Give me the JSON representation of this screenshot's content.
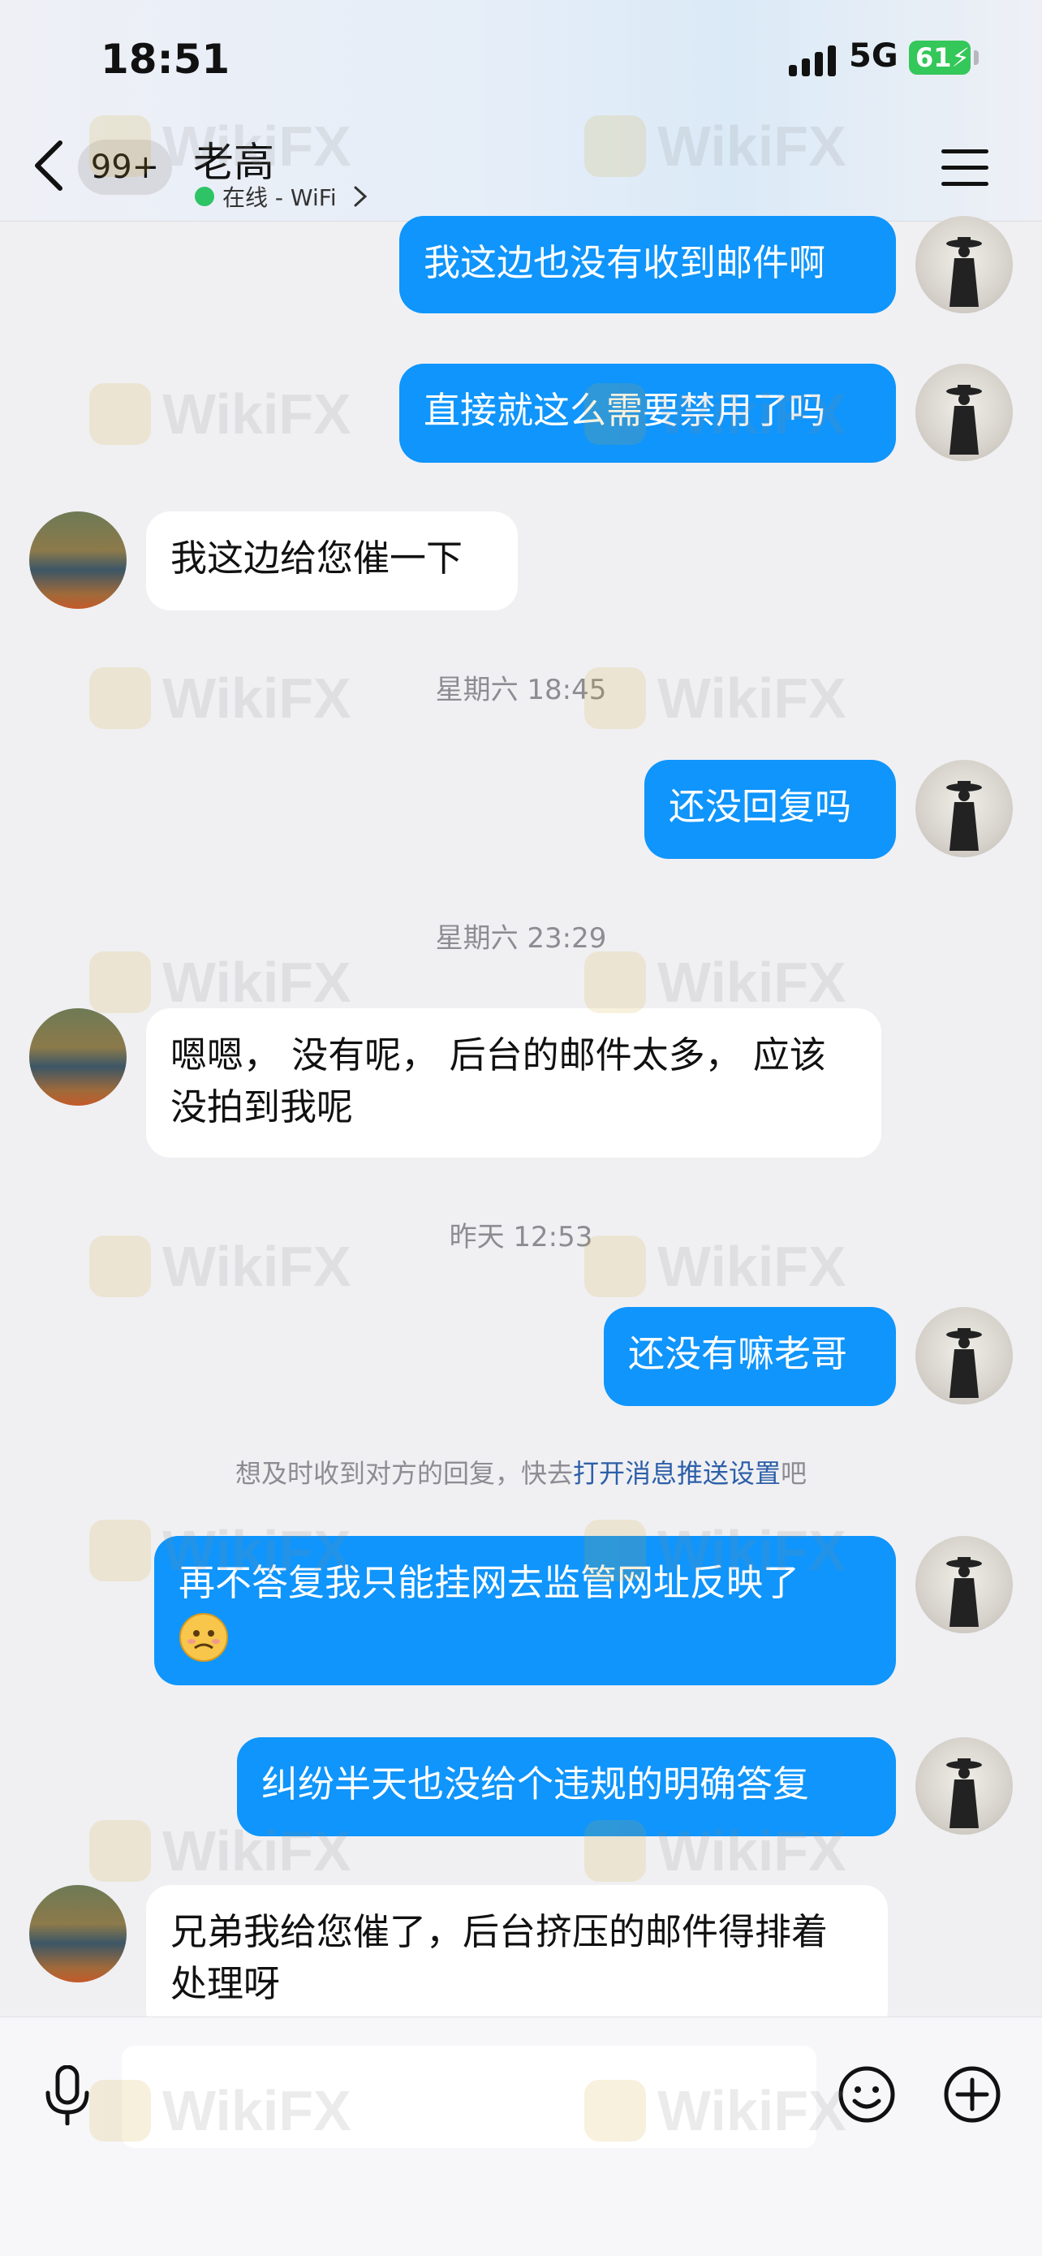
{
  "status": {
    "time": "18:51",
    "network": "5G",
    "battery": "61"
  },
  "header": {
    "unread_badge": "99+",
    "contact_name": "老高",
    "presence": "在线 - WiFi"
  },
  "messages": [
    {
      "side": "out",
      "text": "我这边也没有收到邮件啊"
    },
    {
      "side": "out",
      "text": "直接就这么需要禁用了吗"
    },
    {
      "side": "in",
      "text": "我这边给您催一下"
    },
    {
      "side": "out",
      "text": "还没回复吗"
    },
    {
      "side": "in",
      "text": "嗯嗯， 没有呢， 后台的邮件太多， 应该没拍到我呢"
    },
    {
      "side": "out",
      "text": "还没有嘛老哥"
    },
    {
      "side": "out",
      "text": "再不答复我只能挂网去监管网址反映了"
    },
    {
      "side": "out",
      "text": "纠纷半天也没给个违规的明确答复"
    },
    {
      "side": "in",
      "text": "兄弟我给您催了，后台挤压的邮件得排着处理呀"
    }
  ],
  "timestamps": [
    "星期六 18:45",
    "星期六 23:29",
    "昨天 12:53"
  ],
  "notice": {
    "prefix": "想及时收到对方的回复，快去",
    "link": "打开消息推送设置",
    "suffix": "吧"
  },
  "watermark": "WikiFX",
  "input": {
    "value": "",
    "placeholder": ""
  },
  "colors": {
    "outgoing_bubble": "#0f95fb",
    "incoming_bubble": "#ffffff",
    "online_dot": "#2ec466",
    "battery": "#34c759",
    "link": "#2d5fa8"
  }
}
